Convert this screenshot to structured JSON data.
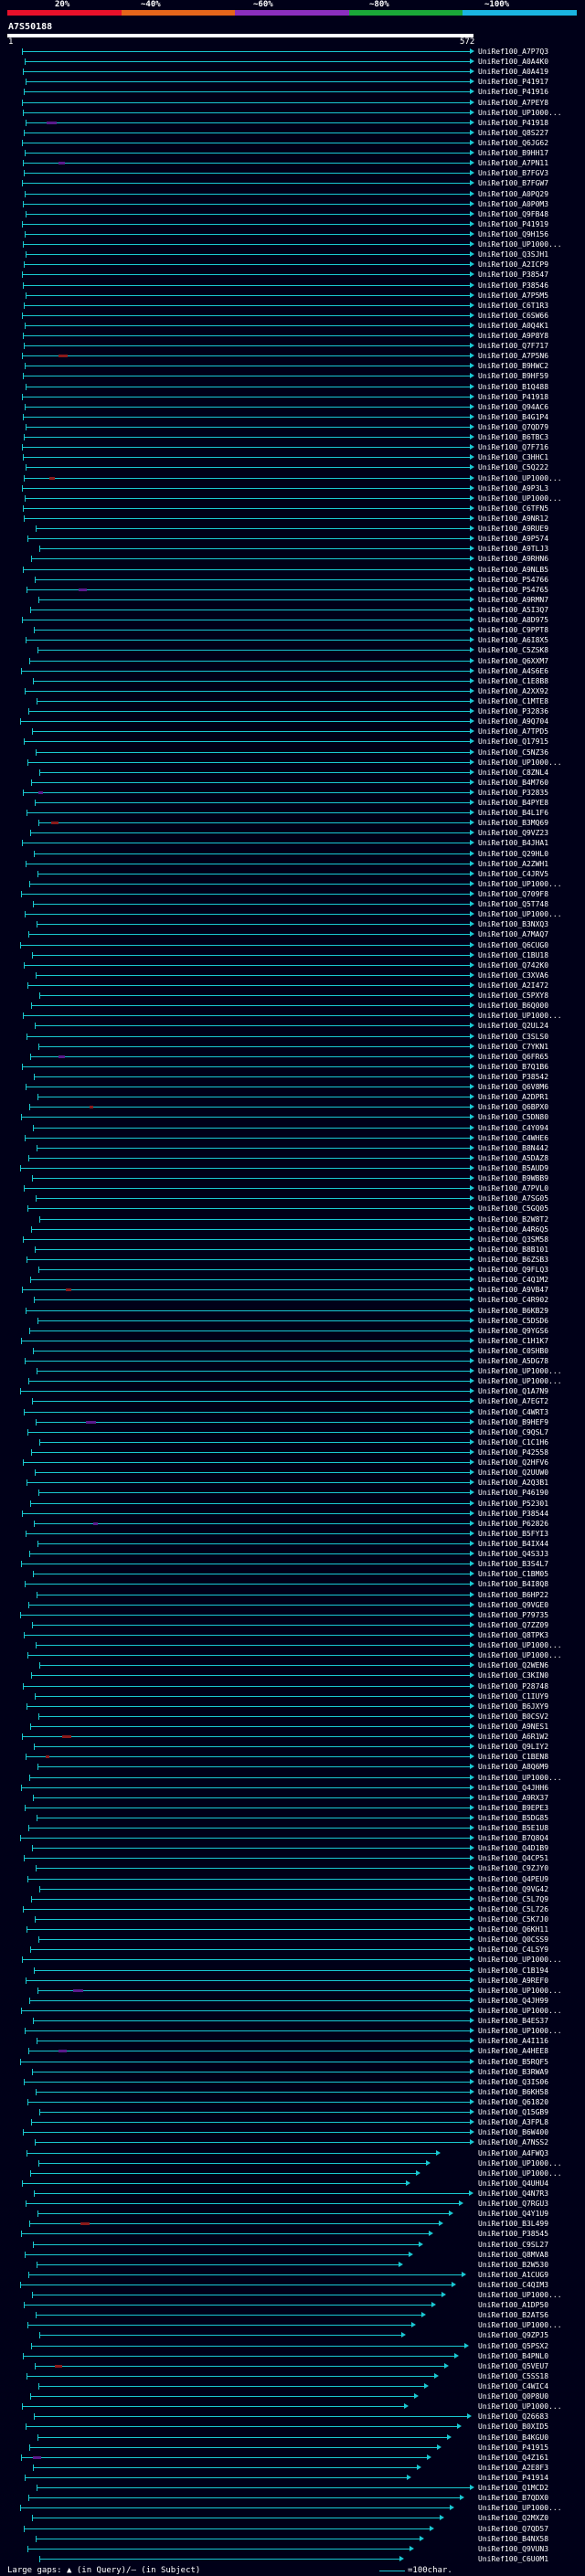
{
  "header": {
    "percent_labels": [
      "20%",
      "~40%",
      "~60%",
      "~80%",
      "~100%"
    ],
    "query_id": "A7S50188",
    "query_start": "1",
    "query_end": "572"
  },
  "colors": {
    "background": "#000018",
    "hit_line": "#19c8d2",
    "hit_line_low": "#86c832",
    "query_bar": "#ffffff",
    "scale": [
      "#e8102a",
      "#e5651b",
      "#8b2fbe",
      "#1aa838",
      "#1ab4e0"
    ]
  },
  "footer": {
    "legend_left": "Large gaps: ▲ (in Query)/— (in Subject)",
    "legend_right": "=100char."
  },
  "hits": [
    "UniRef100_A7P7Q3",
    "UniRef100_A0A4K0",
    "UniRef100_A0A419",
    "UniRef100_P41917",
    "UniRef100_P41916",
    "UniRef100_A7PEY8",
    "UniRef100_UP1000...",
    "UniRef100_P41918",
    "UniRef100_Q8S227",
    "UniRef100_Q6JG62",
    "UniRef100_B9HH17",
    "UniRef100_A7PN11",
    "UniRef100_B7FGV3",
    "UniRef100_B7FGW7",
    "UniRef100_A0PQ29",
    "UniRef100_A0P0M3",
    "UniRef100_Q9FB48",
    "UniRef100_P41919",
    "UniRef100_Q9H156",
    "UniRef100_UP1000...",
    "UniRef100_Q3SJH1",
    "UniRef100_A2ICP9",
    "UniRef100_P38547",
    "UniRef100_P38546",
    "UniRef100_A7P5M5",
    "UniRef100_C6T1R3",
    "UniRef100_C6SW66",
    "UniRef100_A0Q4K1",
    "UniRef100_A9P8Y8",
    "UniRef100_Q7F717",
    "UniRef100_A7P5N6",
    "UniRef100_B9HWC2",
    "UniRef100_B9HF59",
    "UniRef100_B1Q488",
    "UniRef100_P41918",
    "UniRef100_Q94AC6",
    "UniRef100_B4G1P4",
    "UniRef100_Q7QD79",
    "UniRef100_B6TBC3",
    "UniRef100_Q7F716",
    "UniRef100_C3HHC1",
    "UniRef100_C5Q222",
    "UniRef100_UP1000...",
    "UniRef100_A9P3L3",
    "UniRef100_UP1000...",
    "UniRef100_C6TFN5",
    "UniRef100_A9NR12",
    "UniRef100_A9RUE9",
    "UniRef100_A9P574",
    "UniRef100_A9TLJ3",
    "UniRef100_A9RHN6",
    "UniRef100_A9NLB5",
    "UniRef100_P54766",
    "UniRef100_P54765",
    "UniRef100_A9RMN7",
    "UniRef100_A5I3Q7",
    "UniRef100_A8D975",
    "UniRef100_C9PPT8",
    "UniRef100_A6I8X5",
    "UniRef100_C5ZSK8",
    "UniRef100_Q6XXM7",
    "UniRef100_A4S6E6",
    "UniRef100_C1E8B8",
    "UniRef100_A2XX92",
    "UniRef100_C1MTE8",
    "UniRef100_P32836",
    "UniRef100_A9Q704",
    "UniRef100_A7TPD5",
    "UniRef100_Q17915",
    "UniRef100_C5NZ36",
    "UniRef100_UP1000...",
    "UniRef100_C8ZNL4",
    "UniRef100_B4M760",
    "UniRef100_P32835",
    "UniRef100_B4PYE8",
    "UniRef100_B4L1F6",
    "UniRef100_B3MQ69",
    "UniRef100_Q9VZ23",
    "UniRef100_B4JHA1",
    "UniRef100_Q29HL0",
    "UniRef100_A2ZWH1",
    "UniRef100_C4JRV5",
    "UniRef100_UP1000...",
    "UniRef100_Q709F8",
    "UniRef100_Q5T748",
    "UniRef100_UP1000...",
    "UniRef100_B3NXQ3",
    "UniRef100_A7MAQ7",
    "UniRef100_Q6CUG0",
    "UniRef100_C1BU18",
    "UniRef100_Q742K0",
    "UniRef100_C3XVA6",
    "UniRef100_A2I472",
    "UniRef100_C5PXY8",
    "UniRef100_B6Q000",
    "UniRef100_UP1000...",
    "UniRef100_Q2UL24",
    "UniRef100_C3SLS0",
    "UniRef100_C7YKN1",
    "UniRef100_Q6FR65",
    "UniRef100_B7Q1B6",
    "UniRef100_P38542",
    "UniRef100_Q6V8M6",
    "UniRef100_A2DPR1",
    "UniRef100_Q6BPX0",
    "UniRef100_C5DN80",
    "UniRef100_C4Y094",
    "UniRef100_C4WHE6",
    "UniRef100_B8N442",
    "UniRef100_A5DAZ8",
    "UniRef100_B5AUD9",
    "UniRef100_B9WBB9",
    "UniRef100_A7PVL0",
    "UniRef100_A7SG05",
    "UniRef100_C5GQ05",
    "UniRef100_B2W8T2",
    "UniRef100_A4R6Q5",
    "UniRef100_Q3SM58",
    "UniRef100_B8B101",
    "UniRef100_B6ZSB3",
    "UniRef100_Q9FLQ3",
    "UniRef100_C4Q1M2",
    "UniRef100_A9VB47",
    "UniRef100_C4R902",
    "UniRef100_B6KB29",
    "UniRef100_C5DSD6",
    "UniRef100_Q9YGS6",
    "UniRef100_C1H1K7",
    "UniRef100_C0SHB0",
    "UniRef100_A5DG78",
    "UniRef100_UP1000...",
    "UniRef100_UP1000...",
    "UniRef100_Q1A7N9",
    "UniRef100_A7EGT2",
    "UniRef100_C4WRT3",
    "UniRef100_B9HEF9",
    "UniRef100_C9QSL7",
    "UniRef100_C1C1H6",
    "UniRef100_P42558",
    "UniRef100_Q2HFV6",
    "UniRef100_Q2UUW0",
    "UniRef100_A2Q3B1",
    "UniRef100_P46190",
    "UniRef100_P52301",
    "UniRef100_P38544",
    "UniRef100_P62826",
    "UniRef100_B5FYI3",
    "UniRef100_B4IX44",
    "UniRef100_Q4S3J3",
    "UniRef100_B3S4L7",
    "UniRef100_C1BM05",
    "UniRef100_B4I8Q8",
    "UniRef100_B6HP22",
    "UniRef100_Q9VGE0",
    "UniRef100_P79735",
    "UniRef100_Q7ZZ09",
    "UniRef100_Q8TPK3",
    "UniRef100_UP1000...",
    "UniRef100_UP1000...",
    "UniRef100_Q2WEN6",
    "UniRef100_C3KIN0",
    "UniRef100_P28748",
    "UniRef100_C1IUY9",
    "UniRef100_B6JXY9",
    "UniRef100_B0CSV2",
    "UniRef100_A9NES1",
    "UniRef100_A6R1W2",
    "UniRef100_Q9LIY2",
    "UniRef100_C1BEN8",
    "UniRef100_A8Q6M9",
    "UniRef100_UP1000...",
    "UniRef100_Q4JHH6",
    "UniRef100_A9RX37",
    "UniRef100_B9EPE3",
    "UniRef100_B5DG85",
    "UniRef100_B5E1U8",
    "UniRef100_B7Q8Q4",
    "UniRef100_Q4D1B9",
    "UniRef100_Q4CP51",
    "UniRef100_C9ZJY0",
    "UniRef100_Q4PEU9",
    "UniRef100_Q9VG42",
    "UniRef100_C5L7Q9",
    "UniRef100_C5L726",
    "UniRef100_C5K7J0",
    "UniRef100_Q6KH11",
    "UniRef100_Q0CSS9",
    "UniRef100_C4LSY9",
    "UniRef100_UP1000...",
    "UniRef100_C1B194",
    "UniRef100_A9REF0",
    "UniRef100_UP1000...",
    "UniRef100_Q4JH99",
    "UniRef100_UP1000...",
    "UniRef100_B4ES37",
    "UniRef100_UP1000...",
    "UniRef100_A4I116",
    "UniRef100_A4HEE8",
    "UniRef100_B5RQF5",
    "UniRef100_B3RWA9",
    "UniRef100_Q3IS06",
    "UniRef100_B6KH58",
    "UniRef100_Q61820",
    "UniRef100_Q15GB9",
    "UniRef100_A3FPL8",
    "UniRef100_B6W400",
    "UniRef100_A7NSS2",
    "UniRef100_A4FWQ3",
    "UniRef100_UP1000...",
    "UniRef100_UP1000...",
    "UniRef100_Q4UHU4",
    "UniRef100_Q4N7R3",
    "UniRef100_Q7RGU3",
    "UniRef100_Q4Y1U9",
    "UniRef100_B3L499",
    "UniRef100_P38545",
    "UniRef100_C9SL27",
    "UniRef100_Q8MVA8",
    "UniRef100_B2W530",
    "UniRef100_A1CUG9",
    "UniRef100_C4QIM3",
    "UniRef100_UP1000...",
    "UniRef100_A1DP50",
    "UniRef100_B2ATS6",
    "UniRef100_UP1000...",
    "UniRef100_Q9ZPJ5",
    "UniRef100_Q5PSX2",
    "UniRef100_B4PNL0",
    "UniRef100_Q5VEU7",
    "UniRef100_C5SS18",
    "UniRef100_C4WIC4",
    "UniRef100_Q0P8U0",
    "UniRef100_UP1000...",
    "UniRef100_Q26683",
    "UniRef100_B0XID5",
    "UniRef100_B4KGU0",
    "UniRef100_P41915",
    "UniRef100_Q4Z161",
    "UniRef100_A2E8F3",
    "UniRef100_P41914",
    "UniRef100_Q1MCD2",
    "UniRef100_B7QDX0",
    "UniRef100_UP1000...",
    "UniRef100_Q2MXZ0",
    "UniRef100_Q7QD57",
    "UniRef100_B4NX58",
    "UniRef100_Q9VUN3",
    "UniRef100_C6U0M1"
  ]
}
